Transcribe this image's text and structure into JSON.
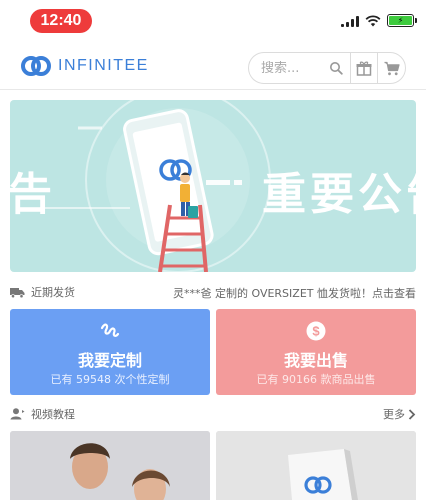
{
  "status_bar": {
    "time": "12:40"
  },
  "header": {
    "logo_text": "INFINITEE",
    "search_placeholder": "搜索...",
    "brand_color": "#3b7fd8"
  },
  "banner": {
    "left_text": "告",
    "right_text": "重要公告",
    "background": "#bde5e3"
  },
  "recent_shipping": {
    "label": "近期发货",
    "info": "灵***爸 定制的 OVERSIZET 恤发货啦！点击查看"
  },
  "cards": [
    {
      "title": "我要定制",
      "subtitle": "已有 59548 次个性定制",
      "color": "#6b9ff3",
      "icon": "custom-swirl-icon"
    },
    {
      "title": "我要出售",
      "subtitle": "已有 90166 款商品出售",
      "color": "#f39b9b",
      "icon": "dollar-icon"
    }
  ],
  "video_section": {
    "label": "视频教程",
    "more": "更多"
  }
}
